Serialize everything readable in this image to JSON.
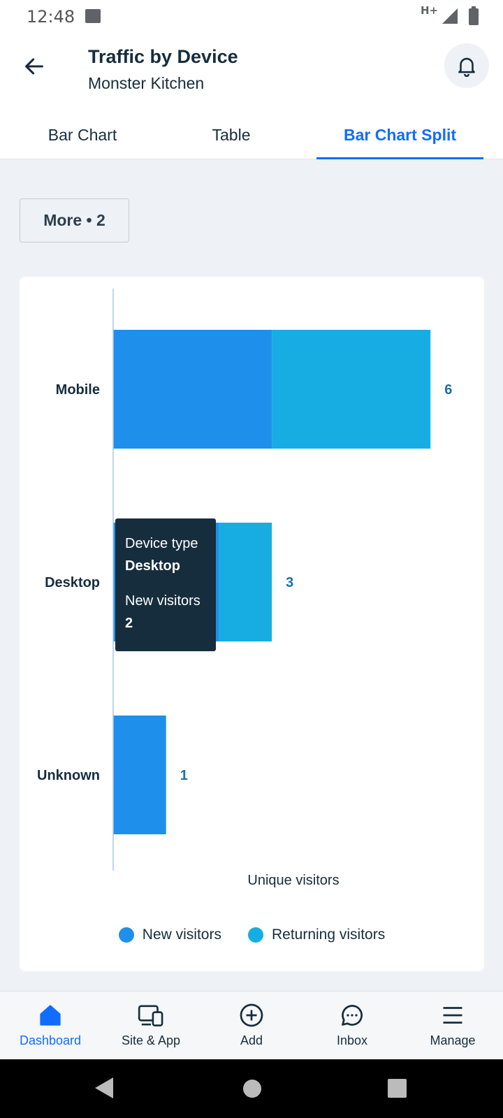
{
  "status_bar": {
    "time": "12:48",
    "network": "H+"
  },
  "header": {
    "title": "Traffic by Device",
    "subtitle": "Monster Kitchen"
  },
  "tabs": [
    {
      "label": "Bar Chart",
      "active": false
    },
    {
      "label": "Table",
      "active": false
    },
    {
      "label": "Bar Chart Split",
      "active": true
    }
  ],
  "filter": {
    "label": "More • 2"
  },
  "colors": {
    "new_visitors": "#1e90eb",
    "returning_visitors": "#17ade3",
    "accent": "#116dff",
    "total_label": "#1d6fa8"
  },
  "chart_data": {
    "type": "bar",
    "orientation": "horizontal",
    "stacked": true,
    "categories": [
      "Mobile",
      "Desktop",
      "Unknown"
    ],
    "series": [
      {
        "name": "New visitors",
        "values": [
          3,
          2,
          1
        ]
      },
      {
        "name": "Returning visitors",
        "values": [
          3,
          1,
          0
        ]
      }
    ],
    "totals": [
      6,
      3,
      1
    ],
    "xlabel": "Unique visitors",
    "ylabel": "",
    "xlim": [
      0,
      6.5
    ],
    "legend_position": "bottom"
  },
  "tooltip": {
    "field1_label": "Device type",
    "field1_value": "Desktop",
    "field2_label": "New visitors",
    "field2_value": "2"
  },
  "bottom_nav": [
    {
      "label": "Dashboard",
      "icon": "home-icon",
      "active": true
    },
    {
      "label": "Site & App",
      "icon": "devices-icon",
      "active": false
    },
    {
      "label": "Add",
      "icon": "plus-circle-icon",
      "active": false
    },
    {
      "label": "Inbox",
      "icon": "chat-bubble-icon",
      "active": false
    },
    {
      "label": "Manage",
      "icon": "menu-icon",
      "active": false
    }
  ]
}
